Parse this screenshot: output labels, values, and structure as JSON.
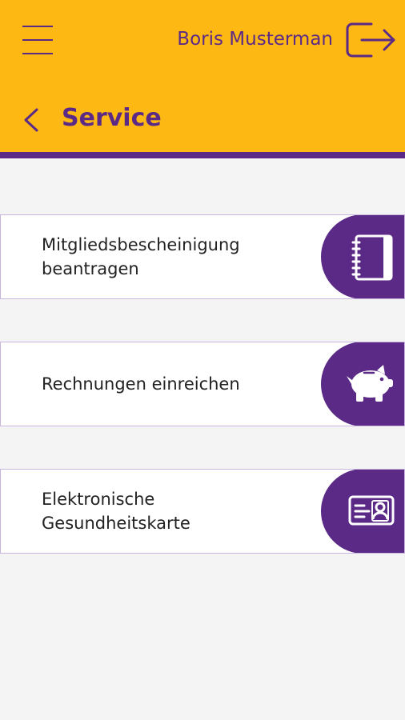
{
  "header": {
    "user_name": "Boris Musterman",
    "title": "Service"
  },
  "services": [
    {
      "label_line1": "Mitgliedsbescheinigung",
      "label_line2": "beantragen",
      "icon": "notebook-icon"
    },
    {
      "label_line1": "Rechnungen einreichen",
      "label_line2": "",
      "icon": "piggy-bank-icon"
    },
    {
      "label_line1": "Elektronische",
      "label_line2": "Gesundheitskarte",
      "icon": "id-card-icon"
    }
  ],
  "colors": {
    "header_bg": "#fdb813",
    "accent": "#5b2a86",
    "page_bg": "#f4f4f4"
  }
}
